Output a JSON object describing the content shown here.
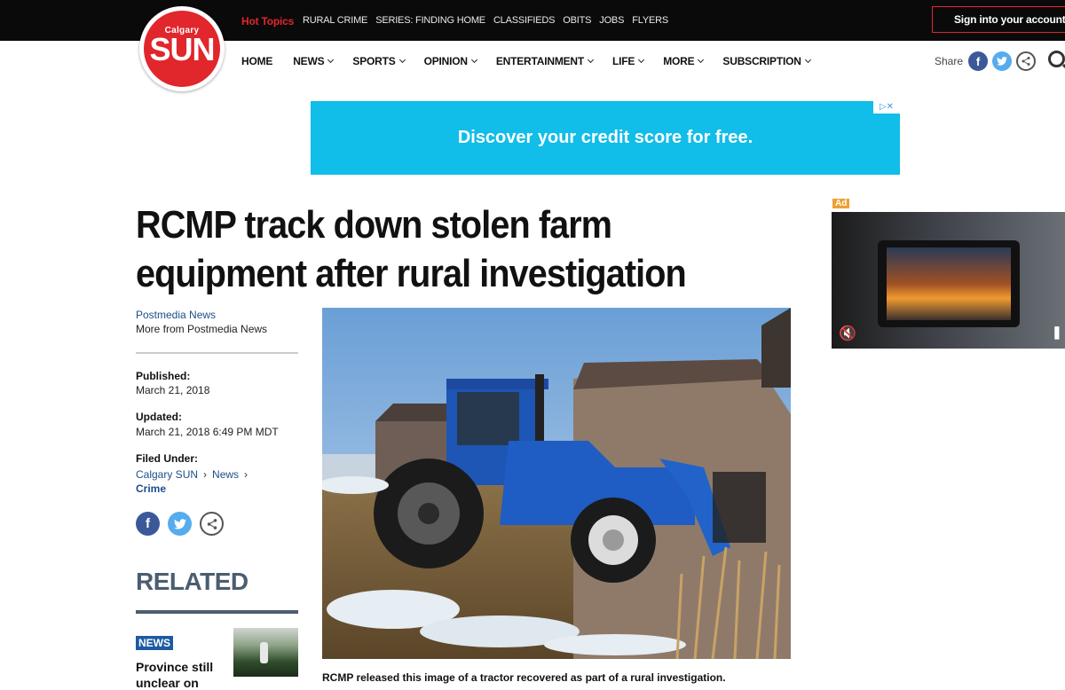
{
  "header": {
    "hot_topics_label": "Hot Topics",
    "topics": [
      "RURAL CRIME",
      "SERIES: FINDING HOME",
      "CLASSIFIEDS",
      "OBITS",
      "JOBS",
      "FLYERS"
    ],
    "signin_label": "Sign into your account"
  },
  "logo": {
    "top": "Calgary",
    "main": "SUN"
  },
  "nav": {
    "items": [
      {
        "label": "HOME",
        "has_dropdown": false
      },
      {
        "label": "NEWS",
        "has_dropdown": true
      },
      {
        "label": "SPORTS",
        "has_dropdown": true
      },
      {
        "label": "OPINION",
        "has_dropdown": true
      },
      {
        "label": "ENTERTAINMENT",
        "has_dropdown": true
      },
      {
        "label": "LIFE",
        "has_dropdown": true
      },
      {
        "label": "MORE",
        "has_dropdown": true
      },
      {
        "label": "SUBSCRIPTION",
        "has_dropdown": true
      }
    ],
    "share_label": "Share"
  },
  "ad_banner": {
    "text": "Discover your credit score for free."
  },
  "article": {
    "headline": "RCMP track down stolen farm equipment after rural investigation",
    "author": "Postmedia News",
    "more_from": "More from Postmedia News",
    "published_label": "Published:",
    "published_value": "March 21, 2018",
    "updated_label": "Updated:",
    "updated_value": "March 21, 2018 6:49 PM MDT",
    "filed_under_label": "Filed Under:",
    "categories": [
      "Calgary SUN",
      "News",
      "Crime"
    ],
    "caption": "RCMP released this image of a tractor recovered as part of a rural investigation."
  },
  "related": {
    "heading": "RELATED",
    "badge": "NEWS",
    "title": "Province still unclear on"
  },
  "side_ad": {
    "label": "Ad"
  },
  "colors": {
    "brand_red": "#e1262c",
    "topbar": "#0a0a0a",
    "link_blue": "#1d4e89",
    "facebook": "#3b5998",
    "twitter": "#55acee",
    "ad_cyan": "#11bde9"
  }
}
